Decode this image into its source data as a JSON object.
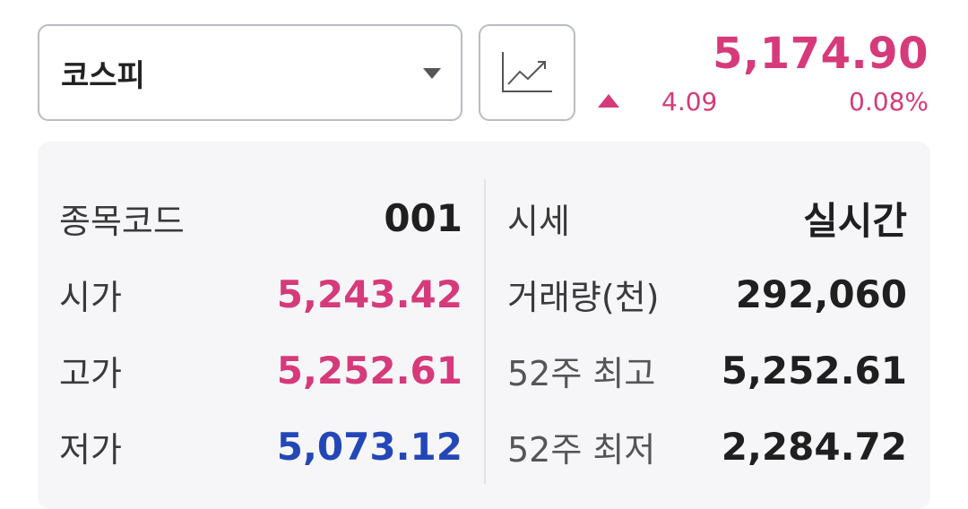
{
  "selector": {
    "value": "코스피"
  },
  "quote": {
    "price": "5,174.90",
    "change_points": "4.09",
    "change_percent": "0.08%",
    "direction": "up",
    "up_color": "#d63a7a",
    "down_color": "#2447b8"
  },
  "icons": {
    "chart_button": "line-chart-icon",
    "change_arrow": "triangle-up-icon",
    "dropdown": "caret-down-icon"
  },
  "left_table": [
    {
      "label": "종목코드",
      "value": "001"
    },
    {
      "label": "시가",
      "value": "5,243.42"
    },
    {
      "label": "고가",
      "value": "5,252.61"
    },
    {
      "label": "저가",
      "value": "5,073.12"
    }
  ],
  "right_table": [
    {
      "label": "시세",
      "value": "실시간"
    },
    {
      "label": "거래량(천)",
      "value": "292,060"
    },
    {
      "label": "52주 최고",
      "value": "5,252.61"
    },
    {
      "label": "52주 최저",
      "value": "2,284.72"
    }
  ]
}
